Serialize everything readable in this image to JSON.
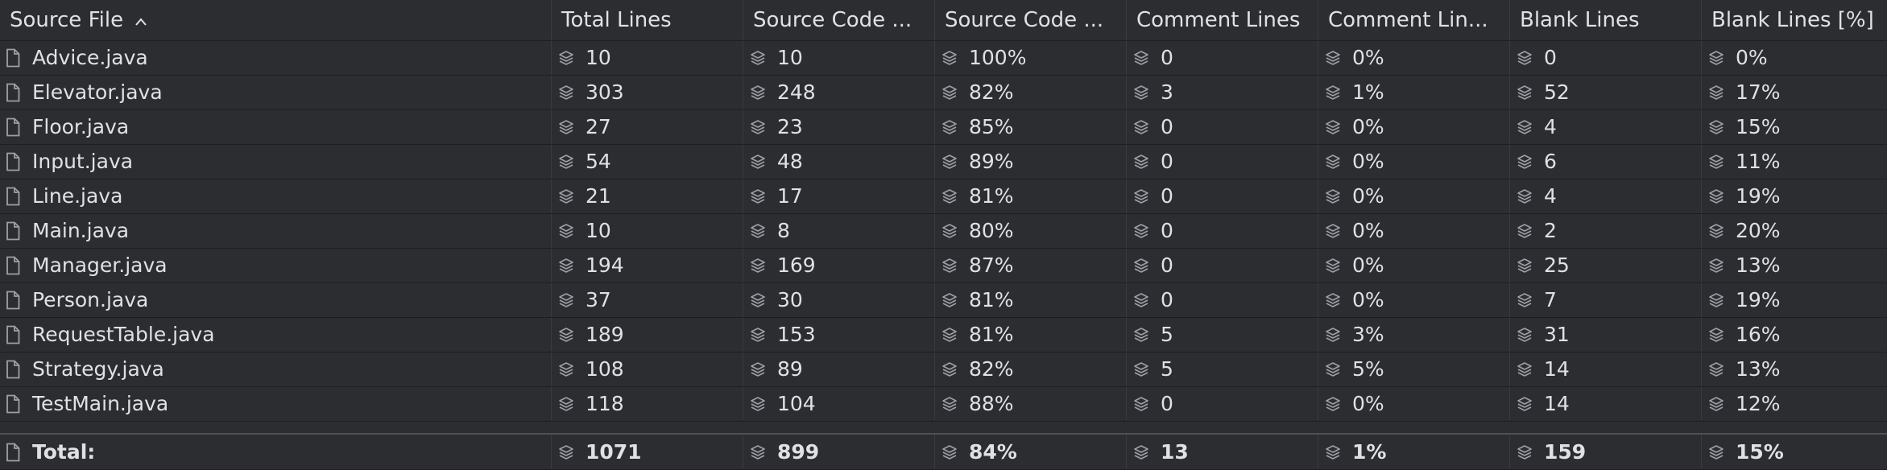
{
  "headers": [
    {
      "label": "Source File",
      "sorted": true
    },
    {
      "label": "Total Lines"
    },
    {
      "label": "Source Code ..."
    },
    {
      "label": "Source Code ..."
    },
    {
      "label": "Comment Lines"
    },
    {
      "label": "Comment Lin..."
    },
    {
      "label": "Blank Lines"
    },
    {
      "label": "Blank Lines [%]"
    }
  ],
  "sort_indicator": "^",
  "rows": [
    {
      "file": "Advice.java",
      "total": "10",
      "code": "10",
      "code_pct": "100%",
      "comment": "0",
      "comment_pct": "0%",
      "blank": "0",
      "blank_pct": "0%"
    },
    {
      "file": "Elevator.java",
      "total": "303",
      "code": "248",
      "code_pct": "82%",
      "comment": "3",
      "comment_pct": "1%",
      "blank": "52",
      "blank_pct": "17%"
    },
    {
      "file": "Floor.java",
      "total": "27",
      "code": "23",
      "code_pct": "85%",
      "comment": "0",
      "comment_pct": "0%",
      "blank": "4",
      "blank_pct": "15%"
    },
    {
      "file": "Input.java",
      "total": "54",
      "code": "48",
      "code_pct": "89%",
      "comment": "0",
      "comment_pct": "0%",
      "blank": "6",
      "blank_pct": "11%"
    },
    {
      "file": "Line.java",
      "total": "21",
      "code": "17",
      "code_pct": "81%",
      "comment": "0",
      "comment_pct": "0%",
      "blank": "4",
      "blank_pct": "19%"
    },
    {
      "file": "Main.java",
      "total": "10",
      "code": "8",
      "code_pct": "80%",
      "comment": "0",
      "comment_pct": "0%",
      "blank": "2",
      "blank_pct": "20%"
    },
    {
      "file": "Manager.java",
      "total": "194",
      "code": "169",
      "code_pct": "87%",
      "comment": "0",
      "comment_pct": "0%",
      "blank": "25",
      "blank_pct": "13%"
    },
    {
      "file": "Person.java",
      "total": "37",
      "code": "30",
      "code_pct": "81%",
      "comment": "0",
      "comment_pct": "0%",
      "blank": "7",
      "blank_pct": "19%"
    },
    {
      "file": "RequestTable.java",
      "total": "189",
      "code": "153",
      "code_pct": "81%",
      "comment": "5",
      "comment_pct": "3%",
      "blank": "31",
      "blank_pct": "16%"
    },
    {
      "file": "Strategy.java",
      "total": "108",
      "code": "89",
      "code_pct": "82%",
      "comment": "5",
      "comment_pct": "5%",
      "blank": "14",
      "blank_pct": "13%"
    },
    {
      "file": "TestMain.java",
      "total": "118",
      "code": "104",
      "code_pct": "88%",
      "comment": "0",
      "comment_pct": "0%",
      "blank": "14",
      "blank_pct": "12%"
    }
  ],
  "total_row": {
    "file": "Total:",
    "total": "1071",
    "code": "899",
    "code_pct": "84%",
    "comment": "13",
    "comment_pct": "1%",
    "blank": "159",
    "blank_pct": "15%"
  },
  "icons": {
    "file": "file-icon",
    "metric": "stack-layers-icon"
  },
  "colors": {
    "background": "#2b2d30",
    "text": "#dfe1e5",
    "icon": "#9da0a8",
    "grid": "#393b40"
  }
}
